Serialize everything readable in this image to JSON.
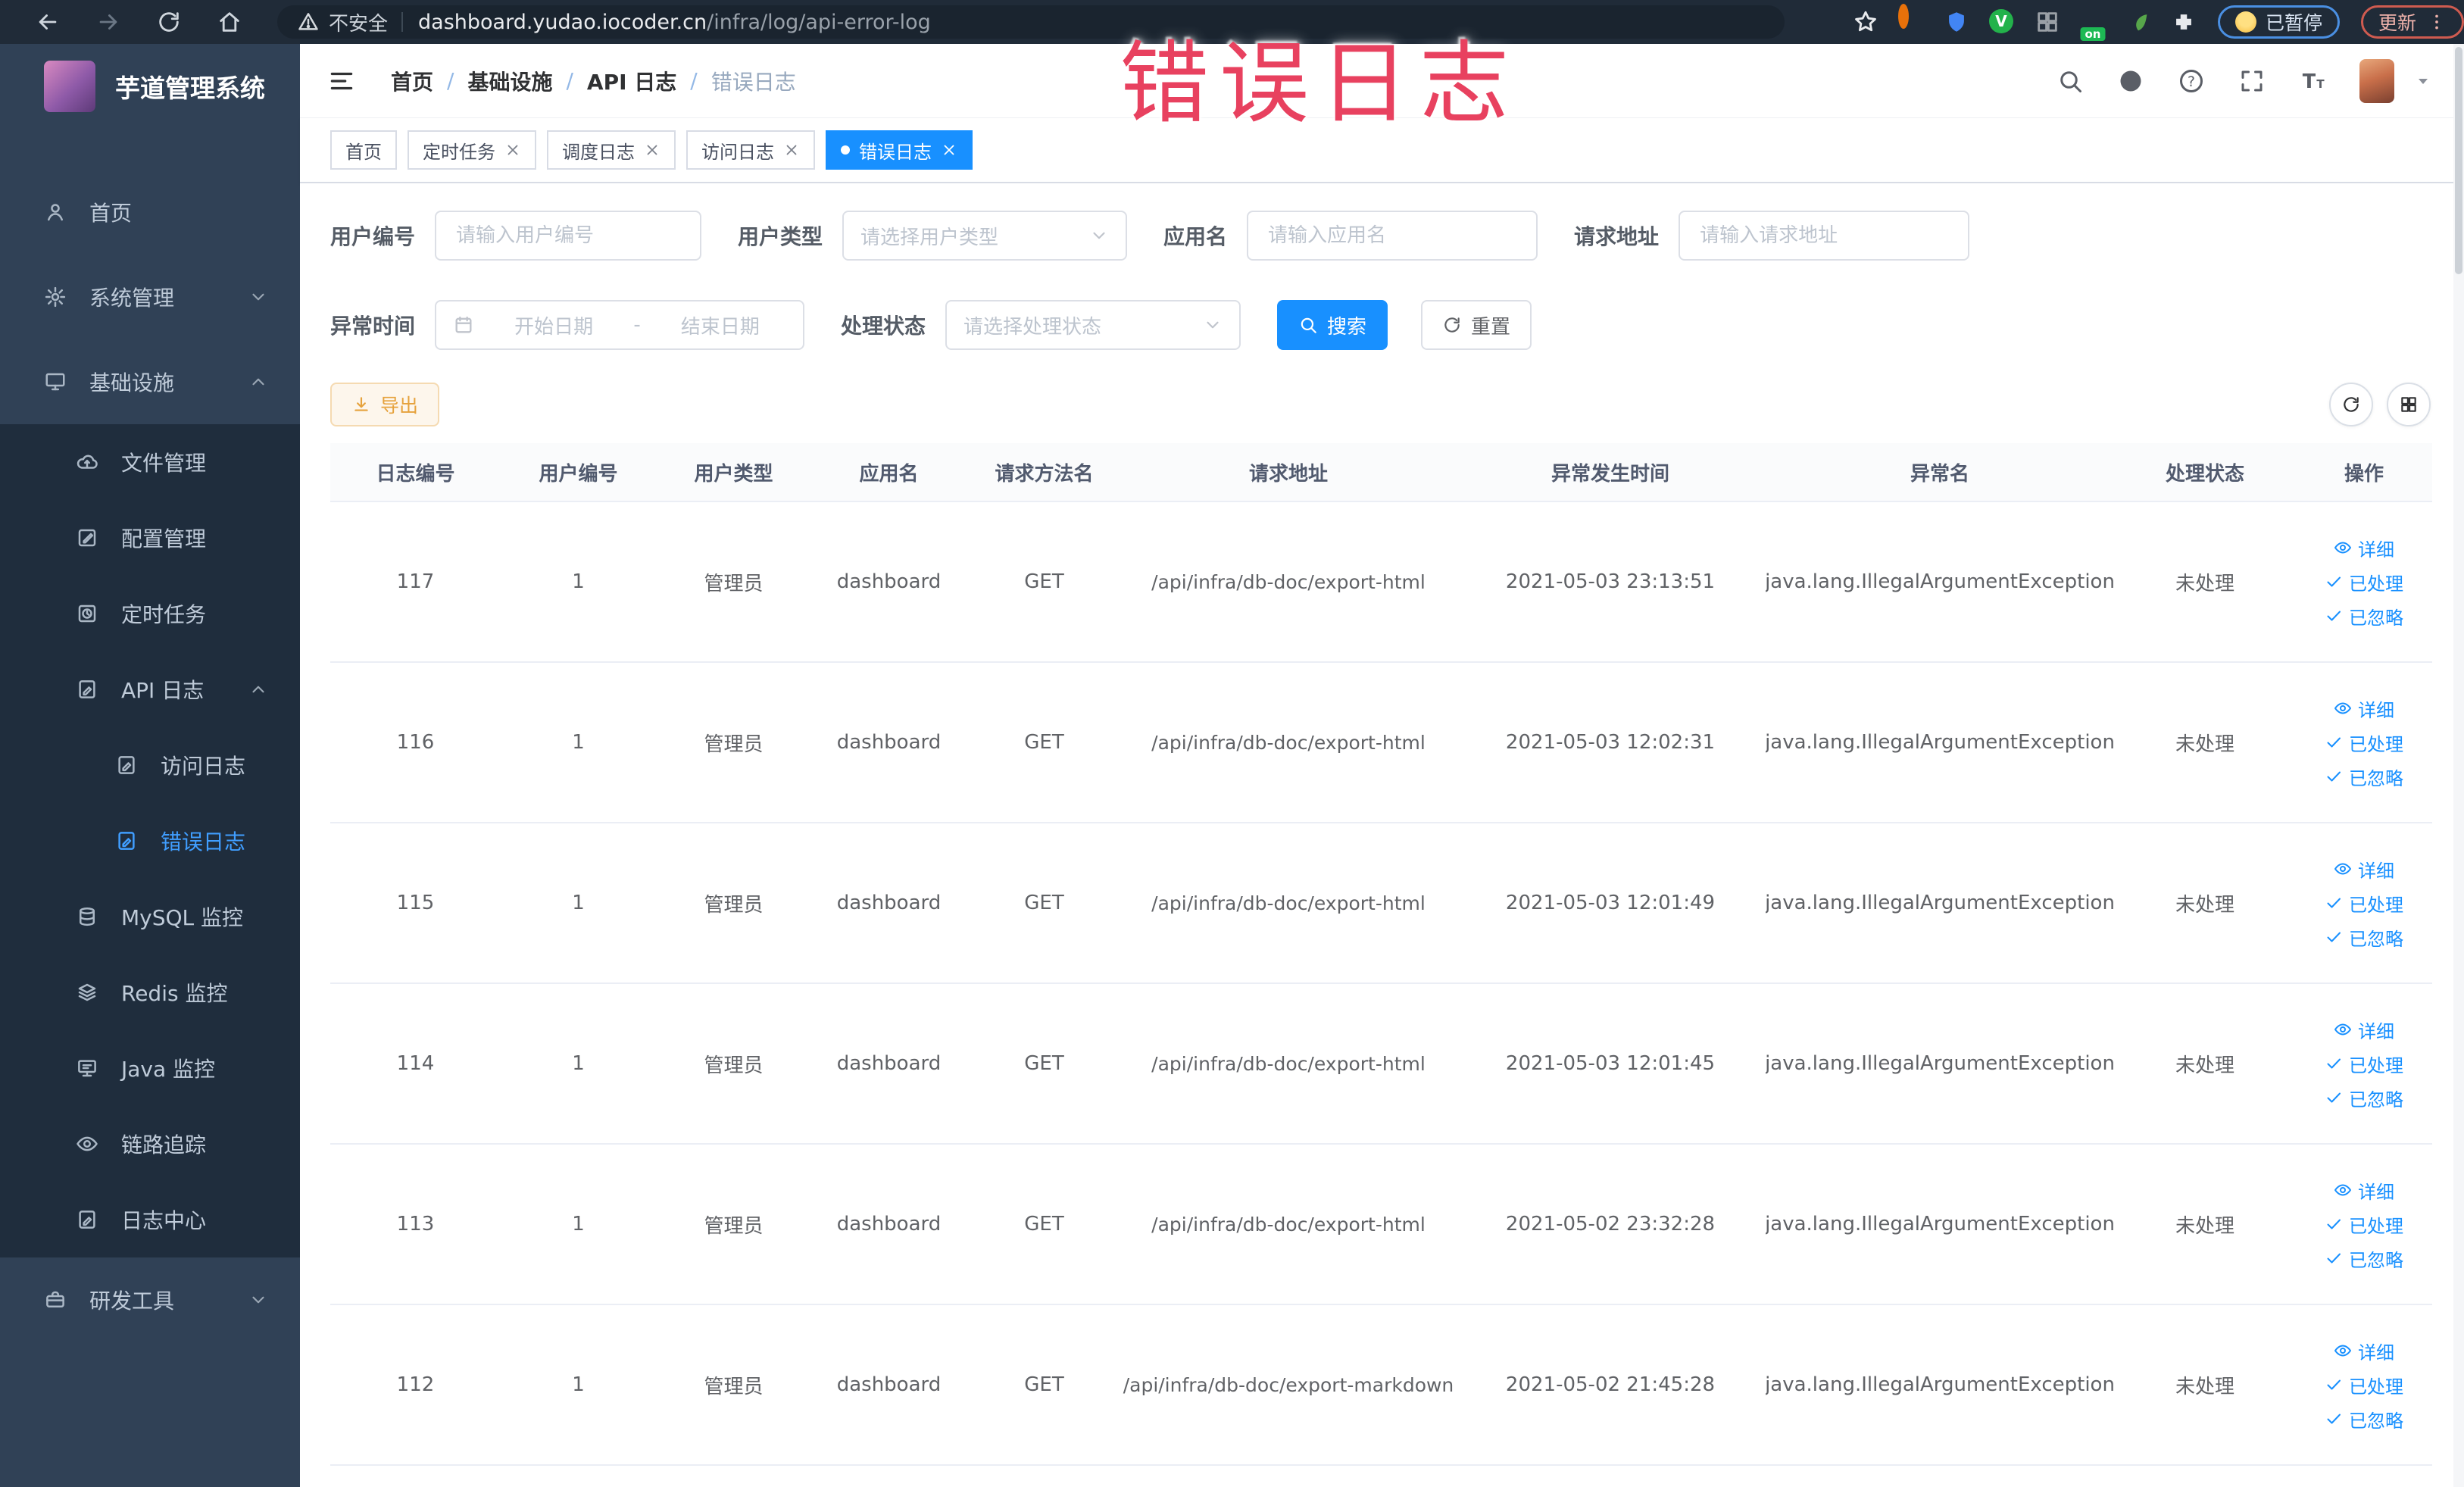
{
  "annotation": {
    "text": "错误日志",
    "color": "#e8415f"
  },
  "browser": {
    "security_label": "不安全",
    "url_domain": "dashboard.yudao.iocoder.cn",
    "url_path": "/infra/log/api-error-log",
    "switch_badge": "on",
    "paused_badge": "已暂停",
    "update_button": "更新"
  },
  "sidebar": {
    "title": "芋道管理系统",
    "items": [
      {
        "name": "home",
        "label": "首页",
        "icon": "person",
        "level": 1
      },
      {
        "name": "system-management",
        "label": "系统管理",
        "icon": "gear",
        "level": 1,
        "chevron": "down"
      },
      {
        "name": "infrastructure",
        "label": "基础设施",
        "icon": "monitor",
        "level": 1,
        "chevron": "up"
      },
      {
        "name": "file-management",
        "label": "文件管理",
        "icon": "cloud",
        "level": 2
      },
      {
        "name": "config-management",
        "label": "配置管理",
        "icon": "editsq",
        "level": 2
      },
      {
        "name": "scheduled-tasks",
        "label": "定时任务",
        "icon": "clocksq",
        "level": 2
      },
      {
        "name": "api-logs",
        "label": "API 日志",
        "icon": "docpen",
        "level": 2,
        "chevron": "up"
      },
      {
        "name": "access-log",
        "label": "访问日志",
        "icon": "docpen",
        "level": 3
      },
      {
        "name": "error-log",
        "label": "错误日志",
        "icon": "docpen",
        "level": 3,
        "active": true
      },
      {
        "name": "mysql-monitor",
        "label": "MySQL 监控",
        "icon": "db",
        "level": 2
      },
      {
        "name": "redis-monitor",
        "label": "Redis 监控",
        "icon": "stack",
        "level": 2
      },
      {
        "name": "java-monitor",
        "label": "Java 监控",
        "icon": "javamon",
        "level": 2
      },
      {
        "name": "trace",
        "label": "链路追踪",
        "icon": "eye",
        "level": 2
      },
      {
        "name": "log-center",
        "label": "日志中心",
        "icon": "docpen",
        "level": 2
      },
      {
        "name": "dev-tools",
        "label": "研发工具",
        "icon": "briefcase",
        "level": 1,
        "chevron": "down"
      }
    ]
  },
  "header": {
    "breadcrumb": [
      "首页",
      "基础设施",
      "API 日志",
      "错误日志"
    ]
  },
  "tabs": [
    {
      "name": "home",
      "label": "首页",
      "closable": false,
      "active": false
    },
    {
      "name": "scheduled-tasks",
      "label": "定时任务",
      "closable": true,
      "active": false
    },
    {
      "name": "schedule-log",
      "label": "调度日志",
      "closable": true,
      "active": false
    },
    {
      "name": "access-log",
      "label": "访问日志",
      "closable": true,
      "active": false
    },
    {
      "name": "error-log",
      "label": "错误日志",
      "closable": true,
      "active": true
    }
  ],
  "filters": {
    "user_id": {
      "label": "用户编号",
      "placeholder": "请输入用户编号"
    },
    "user_type": {
      "label": "用户类型",
      "placeholder": "请选择用户类型"
    },
    "app_name": {
      "label": "应用名",
      "placeholder": "请输入应用名"
    },
    "request_url": {
      "label": "请求地址",
      "placeholder": "请输入请求地址"
    },
    "exception_time": {
      "label": "异常时间",
      "start_placeholder": "开始日期",
      "separator": "-",
      "end_placeholder": "结束日期"
    },
    "process_status": {
      "label": "处理状态",
      "placeholder": "请选择处理状态"
    },
    "search_label": "搜索",
    "reset_label": "重置"
  },
  "toolbar": {
    "export_label": "导出"
  },
  "table": {
    "columns": [
      "日志编号",
      "用户编号",
      "用户类型",
      "应用名",
      "请求方法名",
      "请求地址",
      "异常发生时间",
      "异常名",
      "处理状态",
      "操作"
    ],
    "keys": [
      "id",
      "user_id",
      "user_type",
      "app",
      "method",
      "url",
      "time",
      "exception",
      "status"
    ],
    "actions": {
      "detail": "详细",
      "processed": "已处理",
      "ignored": "已忽略"
    },
    "rows": [
      {
        "id": "117",
        "user_id": "1",
        "user_type": "管理员",
        "app": "dashboard",
        "method": "GET",
        "url": "/api/infra/db-doc/export-html",
        "time": "2021-05-03 23:13:51",
        "exception": "java.lang.IllegalArgumentException",
        "status": "未处理"
      },
      {
        "id": "116",
        "user_id": "1",
        "user_type": "管理员",
        "app": "dashboard",
        "method": "GET",
        "url": "/api/infra/db-doc/export-html",
        "time": "2021-05-03 12:02:31",
        "exception": "java.lang.IllegalArgumentException",
        "status": "未处理"
      },
      {
        "id": "115",
        "user_id": "1",
        "user_type": "管理员",
        "app": "dashboard",
        "method": "GET",
        "url": "/api/infra/db-doc/export-html",
        "time": "2021-05-03 12:01:49",
        "exception": "java.lang.IllegalArgumentException",
        "status": "未处理"
      },
      {
        "id": "114",
        "user_id": "1",
        "user_type": "管理员",
        "app": "dashboard",
        "method": "GET",
        "url": "/api/infra/db-doc/export-html",
        "time": "2021-05-03 12:01:45",
        "exception": "java.lang.IllegalArgumentException",
        "status": "未处理"
      },
      {
        "id": "113",
        "user_id": "1",
        "user_type": "管理员",
        "app": "dashboard",
        "method": "GET",
        "url": "/api/infra/db-doc/export-html",
        "time": "2021-05-02 23:32:28",
        "exception": "java.lang.IllegalArgumentException",
        "status": "未处理"
      },
      {
        "id": "112",
        "user_id": "1",
        "user_type": "管理员",
        "app": "dashboard",
        "method": "GET",
        "url": "/api/infra/db-doc/export-markdown",
        "time": "2021-05-02 21:45:28",
        "exception": "java.lang.IllegalArgumentException",
        "status": "未处理"
      }
    ]
  },
  "colors": {
    "primary": "#1890ff",
    "menu_active": "#409eff",
    "annotation": "#e8415f",
    "warning": "#e6a23c"
  }
}
